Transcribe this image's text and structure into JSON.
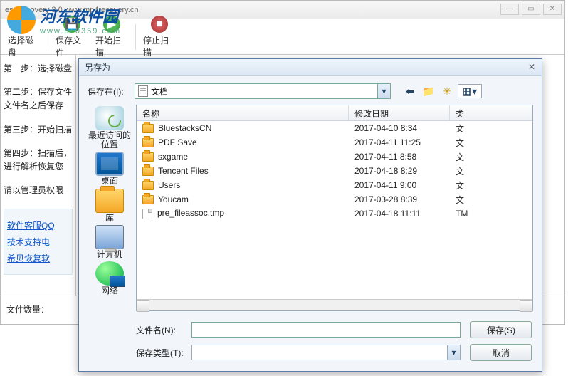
{
  "watermark": {
    "brand": "河东软件园",
    "sub": "www.pc0359.com"
  },
  "main": {
    "title": "ess recovery 3.0    www.mp4recovery.cn",
    "toolbar": {
      "select_disk": "选择磁盘",
      "save_file": "保存文件",
      "start_scan": "开始扫描",
      "stop_scan": "停止扫描"
    },
    "steps": {
      "s1": "第一步：选择磁盘",
      "s2": "第二步：保存文件\n文件名之后保存",
      "s3": "第三步：开始扫描",
      "s4": "第四步：扫描后，\n进行解析恢复您",
      "admin": "请以管理员权限"
    },
    "links": {
      "l1": "软件客服QQ",
      "l2": "技术支持电",
      "l3": "希贝恢复软"
    },
    "status_label": "文件数量："
  },
  "dialog": {
    "title": "另存为",
    "save_in_label": "保存在(I):",
    "location": "文档",
    "columns": {
      "name": "名称",
      "date": "修改日期",
      "type": "类"
    },
    "places": {
      "recent": "最近访问的位置",
      "desktop": "桌面",
      "libraries": "库",
      "computer": "计算机",
      "network": "网络"
    },
    "files": [
      {
        "icon": "folder",
        "name": "BluestacksCN",
        "date": "2017-04-10 8:34",
        "type": "文"
      },
      {
        "icon": "folder",
        "name": "PDF Save",
        "date": "2017-04-11 11:25",
        "type": "文"
      },
      {
        "icon": "folder",
        "name": "sxgame",
        "date": "2017-04-11 8:58",
        "type": "文"
      },
      {
        "icon": "folder",
        "name": "Tencent Files",
        "date": "2017-04-18 8:29",
        "type": "文"
      },
      {
        "icon": "folder",
        "name": "Users",
        "date": "2017-04-11 9:00",
        "type": "文"
      },
      {
        "icon": "folder",
        "name": "Youcam",
        "date": "2017-03-28 8:39",
        "type": "文"
      },
      {
        "icon": "file",
        "name": "pre_fileassoc.tmp",
        "date": "2017-04-18 11:11",
        "type": "TM"
      }
    ],
    "filename_label": "文件名(N):",
    "filetype_label": "保存类型(T):",
    "filename_value": "",
    "filetype_value": "",
    "save_btn": "保存(S)",
    "cancel_btn": "取消"
  }
}
